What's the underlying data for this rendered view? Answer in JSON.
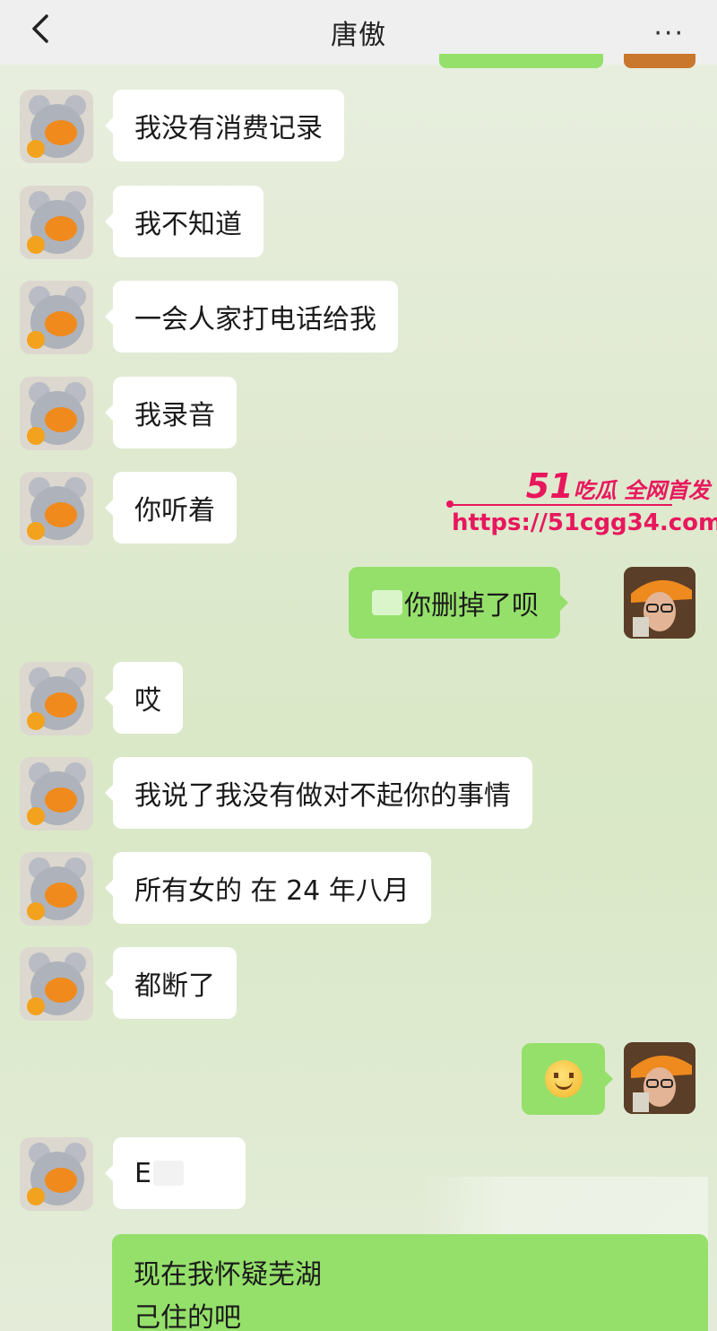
{
  "header": {
    "title": "唐傲",
    "back_icon": "chevron-left-icon",
    "more_label": "···"
  },
  "messages": [
    {
      "side": "left",
      "text": "我没有消费记录"
    },
    {
      "side": "left",
      "text": "我不知道"
    },
    {
      "side": "left",
      "text": "一会人家打电话给我"
    },
    {
      "side": "left",
      "text": "我录音"
    },
    {
      "side": "left",
      "text": "你听着"
    },
    {
      "side": "right",
      "text": "你删掉了呗"
    },
    {
      "side": "left",
      "text": "哎"
    },
    {
      "side": "left",
      "text": "我说了我没有做对不起你的事情"
    },
    {
      "side": "left",
      "text": "所有女的 在 24 年八月"
    },
    {
      "side": "left",
      "text": "都断了"
    },
    {
      "side": "right",
      "emoji": "smiley-emoji"
    },
    {
      "side": "left",
      "text": "E"
    }
  ],
  "bottom_message": {
    "line1": "现在我怀疑芜湖",
    "line2": "己住的吧"
  },
  "watermark": {
    "brand_num": "51",
    "brand_text": "吃瓜 全网首发",
    "url": "https://51cgg34.com"
  },
  "colors": {
    "bubble_right": "#95e06b",
    "bubble_left": "#ffffff",
    "watermark": "#e8175d"
  }
}
